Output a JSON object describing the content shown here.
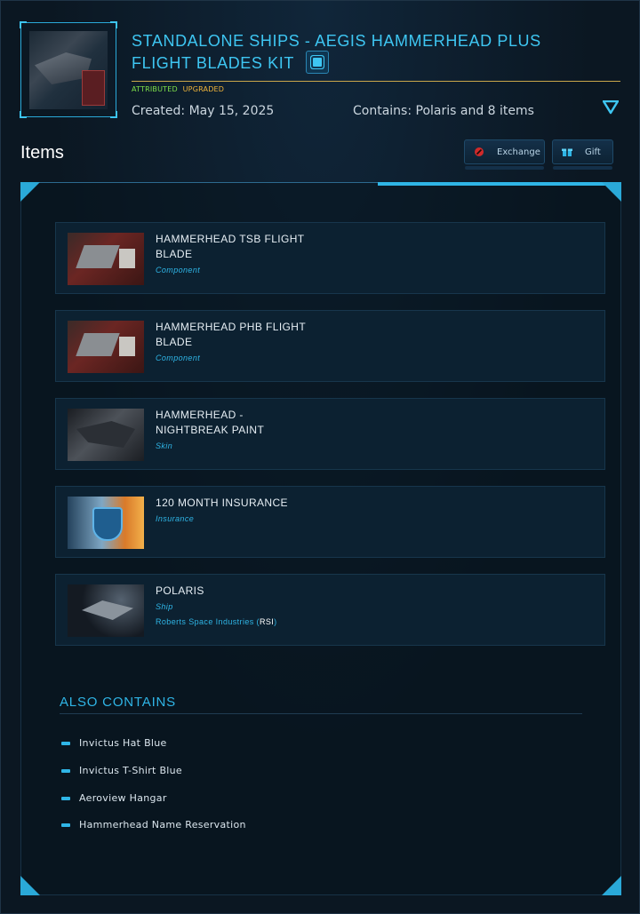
{
  "header": {
    "title": "STANDALONE SHIPS - AEGIS HAMMERHEAD PLUS FLIGHT BLADES KIT",
    "tag_attributed": "ATTRIBUTED",
    "tag_upgraded": "UPGRADED",
    "created": "Created: May 15, 2025",
    "contains": "Contains: Polaris and 8 items"
  },
  "items_section": {
    "title": "Items",
    "exchange_label": "Exchange",
    "gift_label": "Gift"
  },
  "items": [
    {
      "name": "HAMMERHEAD TSB FLIGHT BLADE",
      "type": "Component"
    },
    {
      "name": "HAMMERHEAD PHB FLIGHT BLADE",
      "type": "Component"
    },
    {
      "name": "HAMMERHEAD - NIGHTBREAK PAINT",
      "type": "Skin"
    },
    {
      "name": "120 MONTH INSURANCE",
      "type": "Insurance"
    },
    {
      "name": "POLARIS",
      "type": "Ship",
      "manufacturer": "Roberts Space Industries",
      "manufacturer_code": "RSI"
    }
  ],
  "also_contains": {
    "title": "ALSO CONTAINS",
    "items": [
      "Invictus Hat Blue",
      "Invictus T-Shirt Blue",
      "Aeroview Hangar",
      "Hammerhead Name Reservation"
    ]
  },
  "colors": {
    "accent": "#2fb5e6",
    "attributed": "#7ee04a",
    "upgraded": "#f0b43a",
    "background": "#0b1722"
  }
}
